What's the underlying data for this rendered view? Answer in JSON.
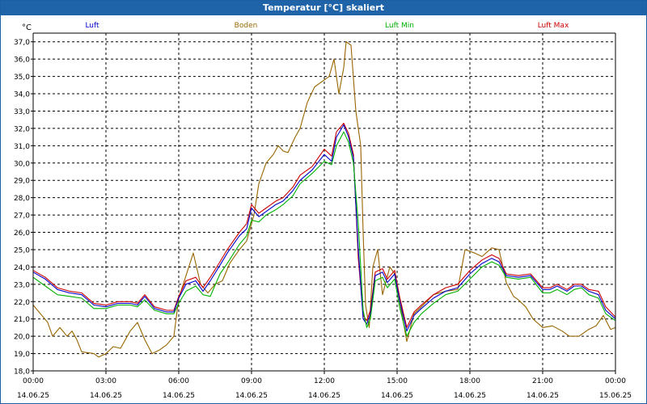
{
  "window": {
    "title": "Temperatur [°C] skaliert"
  },
  "colors": {
    "luft": "#0000cc",
    "boden": "#996600",
    "luft_min": "#00b000",
    "luft_max": "#cc0000",
    "axis": "#000000",
    "grid": "#000000"
  },
  "chart_data": {
    "type": "line",
    "title": "Temperatur [°C] skaliert",
    "ylabel": "°C",
    "xlabel": "",
    "ylim": [
      18.0,
      37.5
    ],
    "xlim": [
      0,
      24
    ],
    "grid": true,
    "legend_position": "top",
    "y_ticks": [
      "18,0",
      "19,0",
      "20,0",
      "21,0",
      "22,0",
      "23,0",
      "24,0",
      "25,0",
      "26,0",
      "27,0",
      "28,0",
      "29,0",
      "30,0",
      "31,0",
      "32,0",
      "33,0",
      "34,0",
      "35,0",
      "36,0",
      "37,0"
    ],
    "x_ticks": [
      {
        "x": 0,
        "time": "00:00",
        "date": "14.06.25"
      },
      {
        "x": 3,
        "time": "03:00",
        "date": "14.06.25"
      },
      {
        "x": 6,
        "time": "06:00",
        "date": "14.06.25"
      },
      {
        "x": 9,
        "time": "09:00",
        "date": "14.06.25"
      },
      {
        "x": 12,
        "time": "12:00",
        "date": "14.06.25"
      },
      {
        "x": 15,
        "time": "15:00",
        "date": "14.06.25"
      },
      {
        "x": 18,
        "time": "18:00",
        "date": "14.06.25"
      },
      {
        "x": 21,
        "time": "21:00",
        "date": "14.06.25"
      },
      {
        "x": 24,
        "time": "00:00",
        "date": "15.06.25"
      }
    ],
    "series": [
      {
        "name": "Luft",
        "color": "#0000cc",
        "points": [
          [
            0,
            23.7
          ],
          [
            0.5,
            23.3
          ],
          [
            1,
            22.7
          ],
          [
            1.5,
            22.5
          ],
          [
            2,
            22.4
          ],
          [
            2.5,
            21.8
          ],
          [
            3,
            21.7
          ],
          [
            3.5,
            21.9
          ],
          [
            4,
            21.9
          ],
          [
            4.3,
            21.8
          ],
          [
            4.6,
            22.3
          ],
          [
            5,
            21.6
          ],
          [
            5.5,
            21.4
          ],
          [
            5.8,
            21.4
          ],
          [
            6,
            22.2
          ],
          [
            6.3,
            23.0
          ],
          [
            6.7,
            23.2
          ],
          [
            7,
            22.6
          ],
          [
            7.3,
            23.2
          ],
          [
            7.7,
            24.1
          ],
          [
            8,
            24.8
          ],
          [
            8.5,
            25.8
          ],
          [
            8.8,
            26.2
          ],
          [
            9,
            27.4
          ],
          [
            9.3,
            26.9
          ],
          [
            9.6,
            27.2
          ],
          [
            10,
            27.6
          ],
          [
            10.3,
            27.8
          ],
          [
            10.7,
            28.4
          ],
          [
            11,
            29.0
          ],
          [
            11.5,
            29.6
          ],
          [
            12,
            30.5
          ],
          [
            12.3,
            30.1
          ],
          [
            12.5,
            31.5
          ],
          [
            12.8,
            32.2
          ],
          [
            13,
            31.5
          ],
          [
            13.2,
            30.3
          ],
          [
            13.4,
            25.0
          ],
          [
            13.6,
            21.0
          ],
          [
            13.75,
            20.7
          ],
          [
            13.9,
            21.3
          ],
          [
            14.1,
            23.5
          ],
          [
            14.4,
            23.7
          ],
          [
            14.6,
            23.1
          ],
          [
            14.9,
            23.6
          ],
          [
            15.1,
            22.1
          ],
          [
            15.4,
            20.3
          ],
          [
            15.7,
            21.2
          ],
          [
            16.0,
            21.6
          ],
          [
            16.5,
            22.2
          ],
          [
            17,
            22.6
          ],
          [
            17.5,
            22.8
          ],
          [
            18,
            23.6
          ],
          [
            18.5,
            24.2
          ],
          [
            18.9,
            24.5
          ],
          [
            19.2,
            24.3
          ],
          [
            19.5,
            23.5
          ],
          [
            20,
            23.4
          ],
          [
            20.5,
            23.5
          ],
          [
            21,
            22.7
          ],
          [
            21.3,
            22.7
          ],
          [
            21.6,
            22.9
          ],
          [
            22,
            22.6
          ],
          [
            22.3,
            22.9
          ],
          [
            22.6,
            22.9
          ],
          [
            22.9,
            22.6
          ],
          [
            23.3,
            22.4
          ],
          [
            23.6,
            21.5
          ],
          [
            24,
            21.0
          ]
        ]
      },
      {
        "name": "Boden",
        "color": "#996600",
        "points": [
          [
            0,
            21.8
          ],
          [
            0.3,
            21.3
          ],
          [
            0.6,
            20.8
          ],
          [
            0.8,
            20.0
          ],
          [
            1.1,
            20.5
          ],
          [
            1.4,
            20.0
          ],
          [
            1.6,
            20.3
          ],
          [
            1.8,
            19.8
          ],
          [
            2,
            19.1
          ],
          [
            2.5,
            19.0
          ],
          [
            2.7,
            18.8
          ],
          [
            3,
            19.0
          ],
          [
            3.3,
            19.4
          ],
          [
            3.6,
            19.3
          ],
          [
            4,
            20.3
          ],
          [
            4.3,
            20.8
          ],
          [
            4.6,
            19.8
          ],
          [
            4.9,
            19.0
          ],
          [
            5.2,
            19.2
          ],
          [
            5.5,
            19.5
          ],
          [
            5.8,
            20.0
          ],
          [
            6,
            22.2
          ],
          [
            6.3,
            23.5
          ],
          [
            6.6,
            24.8
          ],
          [
            6.9,
            23.0
          ],
          [
            7.2,
            22.5
          ],
          [
            7.5,
            23.0
          ],
          [
            7.8,
            23.2
          ],
          [
            8.1,
            24.2
          ],
          [
            8.5,
            25.0
          ],
          [
            8.8,
            25.5
          ],
          [
            9.1,
            27.0
          ],
          [
            9.3,
            28.8
          ],
          [
            9.6,
            30.0
          ],
          [
            9.9,
            30.5
          ],
          [
            10.1,
            31.0
          ],
          [
            10.3,
            30.7
          ],
          [
            10.5,
            30.6
          ],
          [
            10.8,
            31.5
          ],
          [
            11,
            32.0
          ],
          [
            11.3,
            33.5
          ],
          [
            11.6,
            34.4
          ],
          [
            12,
            34.8
          ],
          [
            12.2,
            35.0
          ],
          [
            12.4,
            36.0
          ],
          [
            12.6,
            34.0
          ],
          [
            12.8,
            35.5
          ],
          [
            12.9,
            37.0
          ],
          [
            13.1,
            36.8
          ],
          [
            13.3,
            33.0
          ],
          [
            13.5,
            31.0
          ],
          [
            13.6,
            26.0
          ],
          [
            13.7,
            21.8
          ],
          [
            13.85,
            20.5
          ],
          [
            14.0,
            24.0
          ],
          [
            14.2,
            25.0
          ],
          [
            14.4,
            22.4
          ],
          [
            14.7,
            24.0
          ],
          [
            14.9,
            23.6
          ],
          [
            15.2,
            21.3
          ],
          [
            15.4,
            19.7
          ],
          [
            15.7,
            21.3
          ],
          [
            16,
            21.7
          ],
          [
            16.5,
            22.4
          ],
          [
            17,
            22.6
          ],
          [
            17.5,
            22.7
          ],
          [
            17.8,
            25.0
          ],
          [
            18.2,
            24.8
          ],
          [
            18.5,
            24.6
          ],
          [
            18.9,
            25.1
          ],
          [
            19.2,
            25.0
          ],
          [
            19.5,
            23.1
          ],
          [
            19.8,
            22.3
          ],
          [
            20,
            22.1
          ],
          [
            20.3,
            21.7
          ],
          [
            20.6,
            21.0
          ],
          [
            21,
            20.5
          ],
          [
            21.4,
            20.6
          ],
          [
            21.8,
            20.3
          ],
          [
            22.1,
            20.0
          ],
          [
            22.5,
            20.0
          ],
          [
            22.9,
            20.4
          ],
          [
            23.2,
            20.6
          ],
          [
            23.5,
            21.2
          ],
          [
            23.8,
            20.4
          ],
          [
            24,
            20.5
          ]
        ]
      },
      {
        "name": "Luft Min",
        "color": "#00b000",
        "points": [
          [
            0,
            23.4
          ],
          [
            0.5,
            22.9
          ],
          [
            1,
            22.4
          ],
          [
            1.5,
            22.3
          ],
          [
            2,
            22.2
          ],
          [
            2.5,
            21.6
          ],
          [
            3,
            21.6
          ],
          [
            3.5,
            21.8
          ],
          [
            4,
            21.8
          ],
          [
            4.3,
            21.7
          ],
          [
            4.6,
            22.1
          ],
          [
            5,
            21.5
          ],
          [
            5.5,
            21.3
          ],
          [
            5.8,
            21.3
          ],
          [
            6,
            21.9
          ],
          [
            6.3,
            22.6
          ],
          [
            6.7,
            22.9
          ],
          [
            7,
            22.4
          ],
          [
            7.3,
            22.3
          ],
          [
            7.7,
            23.6
          ],
          [
            8,
            24.2
          ],
          [
            8.5,
            25.3
          ],
          [
            8.8,
            25.8
          ],
          [
            9,
            26.7
          ],
          [
            9.3,
            26.6
          ],
          [
            9.6,
            27.0
          ],
          [
            10,
            27.3
          ],
          [
            10.3,
            27.6
          ],
          [
            10.7,
            28.1
          ],
          [
            11,
            28.8
          ],
          [
            11.5,
            29.4
          ],
          [
            12,
            30.1
          ],
          [
            12.3,
            29.9
          ],
          [
            12.5,
            31.0
          ],
          [
            12.8,
            31.8
          ],
          [
            13,
            31.2
          ],
          [
            13.2,
            30.0
          ],
          [
            13.4,
            26.5
          ],
          [
            13.6,
            21.5
          ],
          [
            13.75,
            20.5
          ],
          [
            13.9,
            21.0
          ],
          [
            14.1,
            23.2
          ],
          [
            14.4,
            23.4
          ],
          [
            14.6,
            22.8
          ],
          [
            14.9,
            23.3
          ],
          [
            15.1,
            21.7
          ],
          [
            15.4,
            20.0
          ],
          [
            15.7,
            20.8
          ],
          [
            16.0,
            21.3
          ],
          [
            16.5,
            21.9
          ],
          [
            17,
            22.4
          ],
          [
            17.5,
            22.6
          ],
          [
            18,
            23.3
          ],
          [
            18.5,
            24.0
          ],
          [
            18.9,
            24.3
          ],
          [
            19.2,
            24.1
          ],
          [
            19.5,
            23.4
          ],
          [
            20,
            23.3
          ],
          [
            20.5,
            23.4
          ],
          [
            21,
            22.5
          ],
          [
            21.3,
            22.5
          ],
          [
            21.6,
            22.7
          ],
          [
            22,
            22.4
          ],
          [
            22.3,
            22.7
          ],
          [
            22.6,
            22.8
          ],
          [
            22.9,
            22.4
          ],
          [
            23.3,
            22.2
          ],
          [
            23.6,
            21.3
          ],
          [
            24,
            20.9
          ]
        ]
      },
      {
        "name": "Luft Max",
        "color": "#cc0000",
        "points": [
          [
            0,
            23.8
          ],
          [
            0.5,
            23.4
          ],
          [
            1,
            22.8
          ],
          [
            1.5,
            22.6
          ],
          [
            2,
            22.5
          ],
          [
            2.5,
            21.9
          ],
          [
            3,
            21.8
          ],
          [
            3.5,
            22.0
          ],
          [
            4,
            22.0
          ],
          [
            4.3,
            21.9
          ],
          [
            4.6,
            22.4
          ],
          [
            5,
            21.7
          ],
          [
            5.5,
            21.5
          ],
          [
            5.8,
            21.5
          ],
          [
            6,
            22.3
          ],
          [
            6.3,
            23.2
          ],
          [
            6.7,
            23.4
          ],
          [
            7,
            22.8
          ],
          [
            7.3,
            23.4
          ],
          [
            7.7,
            24.3
          ],
          [
            8,
            25.0
          ],
          [
            8.5,
            26.0
          ],
          [
            8.8,
            26.5
          ],
          [
            9,
            27.6
          ],
          [
            9.3,
            27.1
          ],
          [
            9.6,
            27.4
          ],
          [
            10,
            27.8
          ],
          [
            10.3,
            28.0
          ],
          [
            10.7,
            28.6
          ],
          [
            11,
            29.3
          ],
          [
            11.5,
            29.8
          ],
          [
            12,
            30.8
          ],
          [
            12.3,
            30.4
          ],
          [
            12.5,
            31.8
          ],
          [
            12.8,
            32.3
          ],
          [
            13,
            31.7
          ],
          [
            13.2,
            30.5
          ],
          [
            13.4,
            24.5
          ],
          [
            13.6,
            21.2
          ],
          [
            13.75,
            20.9
          ],
          [
            13.9,
            21.5
          ],
          [
            14.1,
            23.7
          ],
          [
            14.4,
            23.9
          ],
          [
            14.6,
            23.3
          ],
          [
            14.9,
            23.8
          ],
          [
            15.1,
            22.3
          ],
          [
            15.4,
            20.5
          ],
          [
            15.7,
            21.4
          ],
          [
            16.0,
            21.8
          ],
          [
            16.5,
            22.4
          ],
          [
            17,
            22.8
          ],
          [
            17.5,
            23.0
          ],
          [
            18,
            23.8
          ],
          [
            18.5,
            24.4
          ],
          [
            18.9,
            24.7
          ],
          [
            19.2,
            24.5
          ],
          [
            19.5,
            23.6
          ],
          [
            20,
            23.5
          ],
          [
            20.5,
            23.6
          ],
          [
            21,
            22.8
          ],
          [
            21.3,
            22.8
          ],
          [
            21.6,
            23.0
          ],
          [
            22,
            22.7
          ],
          [
            22.3,
            23.0
          ],
          [
            22.6,
            23.0
          ],
          [
            22.9,
            22.7
          ],
          [
            23.3,
            22.6
          ],
          [
            23.6,
            21.7
          ],
          [
            24,
            21.1
          ]
        ]
      }
    ]
  }
}
